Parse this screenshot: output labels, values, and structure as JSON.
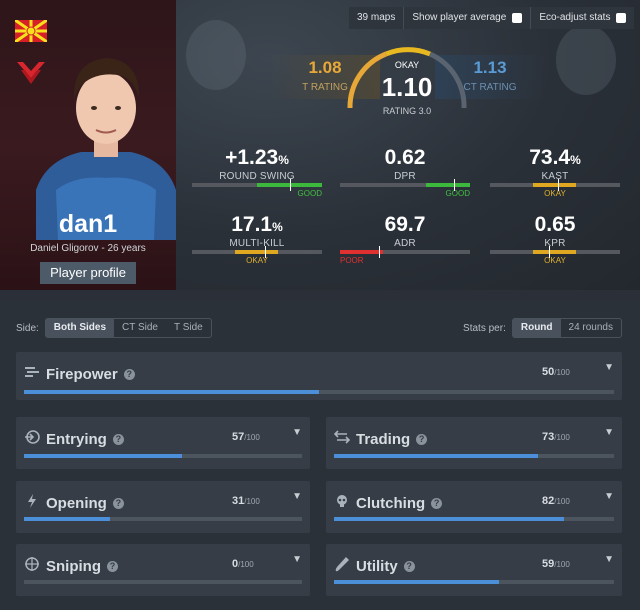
{
  "controls": {
    "maps": "39 maps",
    "show_avg": "Show player average",
    "eco": "Eco-adjust stats"
  },
  "player": {
    "name": "dan1",
    "sub": "Daniel Gligorov - 26 years",
    "profile_btn": "Player profile"
  },
  "rating": {
    "t_value": "1.08",
    "t_label": "T RATING",
    "ct_value": "1.13",
    "ct_label": "CT RATING",
    "main_tag": "OKAY",
    "main_value": "1.10",
    "main_label": "RATING 3.0"
  },
  "stats": [
    {
      "value": "+1.23",
      "unit": "%",
      "name": "ROUND SWING",
      "quality": "GOOD",
      "fill_from": 0.5,
      "fill_to": 1.0,
      "marker": 0.75,
      "color": "#3cb83c"
    },
    {
      "value": "0.62",
      "unit": "",
      "name": "DPR",
      "quality": "GOOD",
      "fill_from": 0.66,
      "fill_to": 1.0,
      "marker": 0.88,
      "color": "#3cb83c"
    },
    {
      "value": "73.4",
      "unit": "%",
      "name": "KAST",
      "quality": "OKAY",
      "fill_from": 0.33,
      "fill_to": 0.66,
      "marker": 0.52,
      "color": "#e0a820"
    },
    {
      "value": "17.1",
      "unit": "%",
      "name": "MULTI-KILL",
      "quality": "OKAY",
      "fill_from": 0.33,
      "fill_to": 0.66,
      "marker": 0.56,
      "color": "#e0a820"
    },
    {
      "value": "69.7",
      "unit": "",
      "name": "ADR",
      "quality": "POOR",
      "fill_from": 0.0,
      "fill_to": 0.33,
      "marker": 0.3,
      "color": "#e03030"
    },
    {
      "value": "0.65",
      "unit": "",
      "name": "KPR",
      "quality": "OKAY",
      "fill_from": 0.33,
      "fill_to": 0.66,
      "marker": 0.45,
      "color": "#e0a820"
    }
  ],
  "filters": {
    "side_label": "Side:",
    "side_options": [
      "Both Sides",
      "CT Side",
      "T Side"
    ],
    "per_label": "Stats per:",
    "per_options": [
      "Round",
      "24 rounds"
    ]
  },
  "categories": [
    {
      "name": "Firepower",
      "score": "50",
      "max": "/100",
      "pct": 0.5,
      "icon": "firepower-icon"
    },
    {
      "name": "Entrying",
      "score": "57",
      "max": "/100",
      "pct": 0.57,
      "icon": "entry-icon"
    },
    {
      "name": "Trading",
      "score": "73",
      "max": "/100",
      "pct": 0.73,
      "icon": "trading-icon"
    },
    {
      "name": "Opening",
      "score": "31",
      "max": "/100",
      "pct": 0.31,
      "icon": "opening-icon"
    },
    {
      "name": "Clutching",
      "score": "82",
      "max": "/100",
      "pct": 0.82,
      "icon": "clutching-icon"
    },
    {
      "name": "Sniping",
      "score": "0",
      "max": "/100",
      "pct": 0.0,
      "icon": "crosshair-icon"
    },
    {
      "name": "Utility",
      "score": "59",
      "max": "/100",
      "pct": 0.59,
      "icon": "utility-icon"
    }
  ]
}
